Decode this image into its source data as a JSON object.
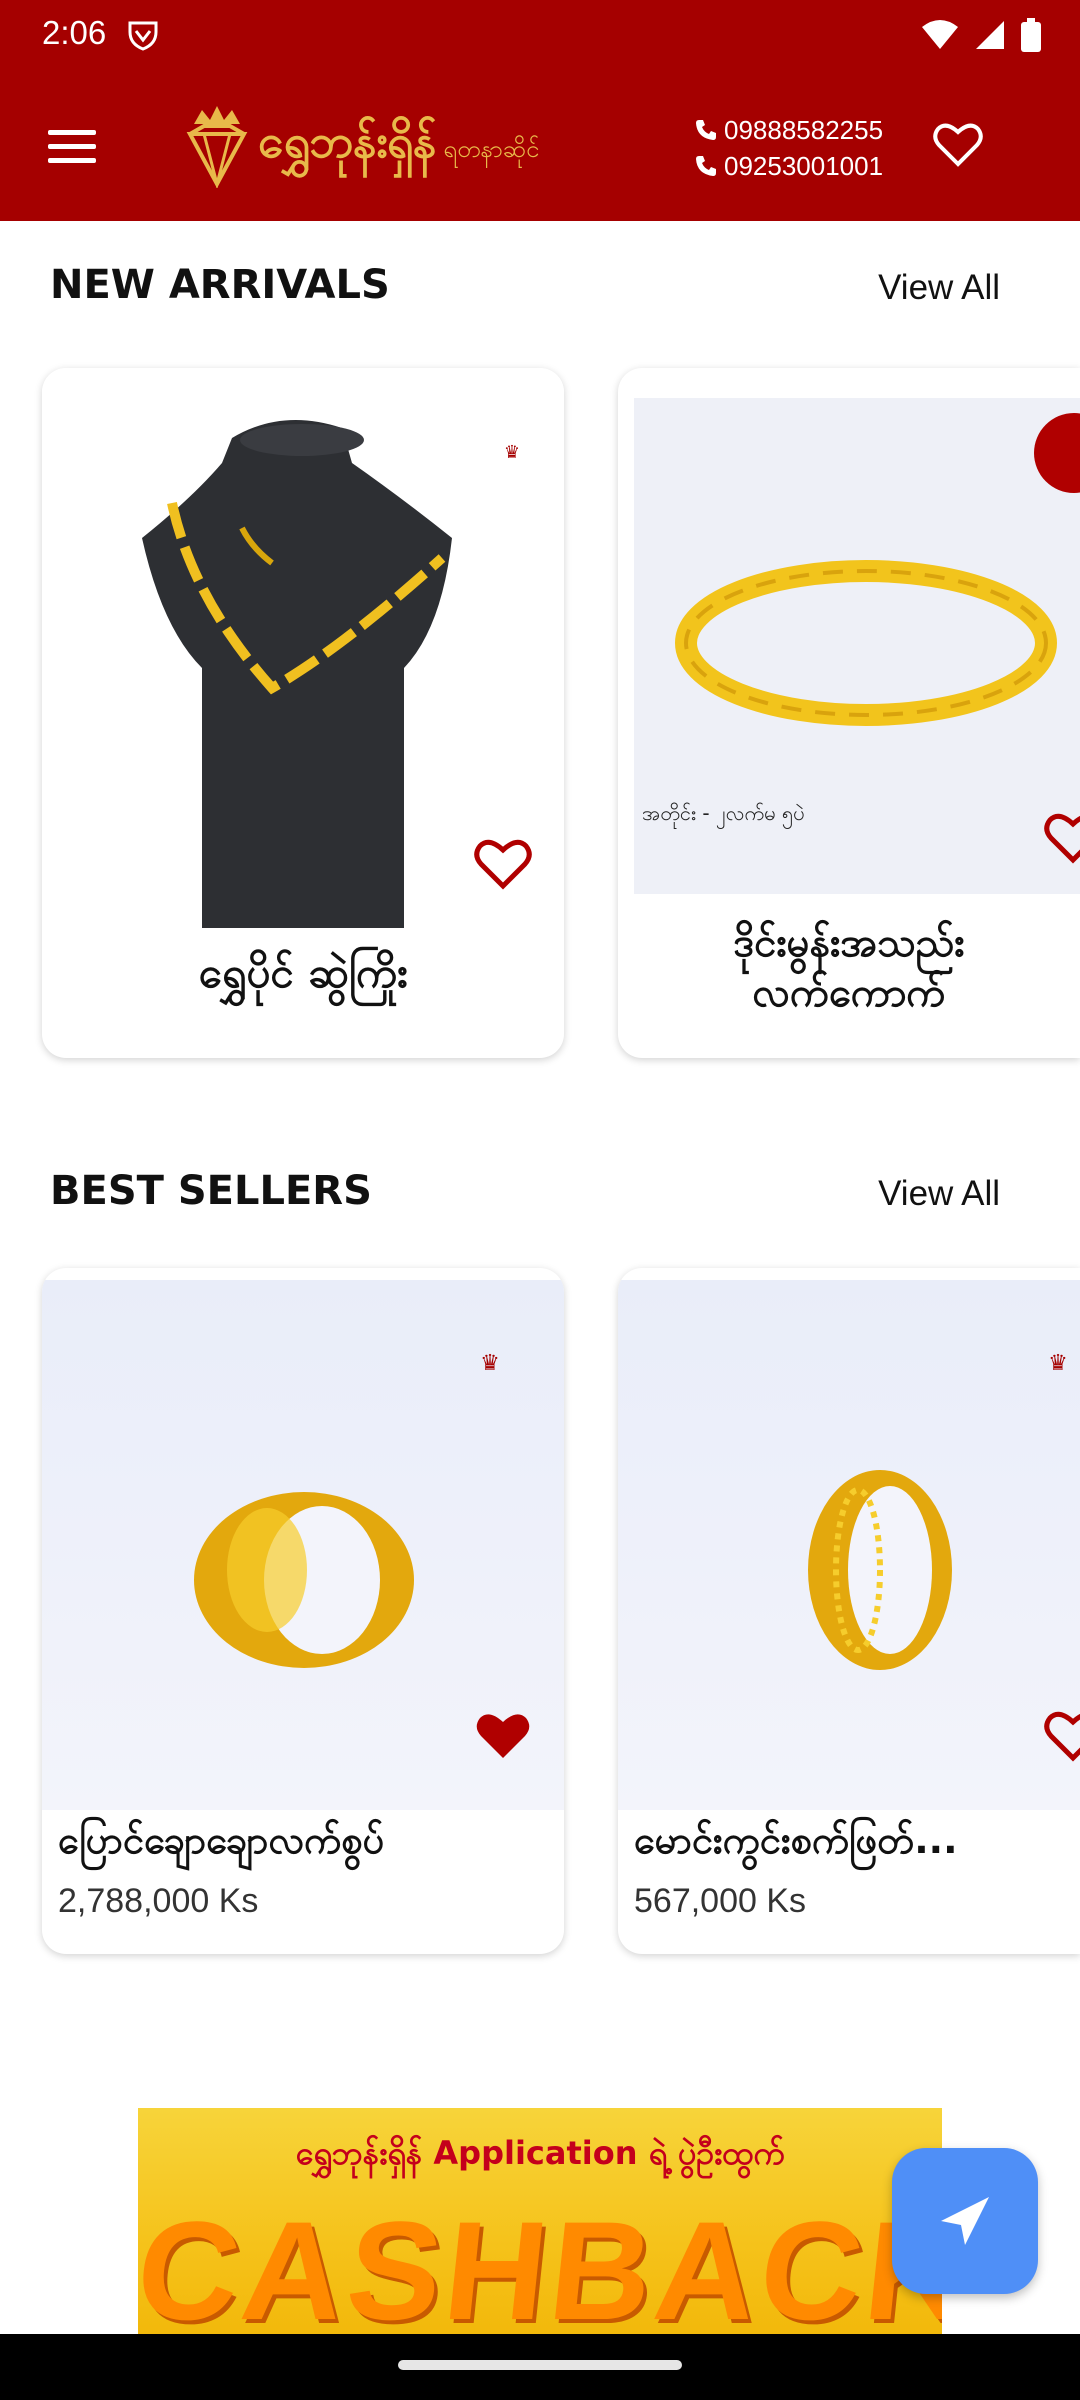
{
  "status_bar": {
    "time": "2:06"
  },
  "header": {
    "brand_name": "ရွှေဘုန်းရှိန်",
    "brand_sub": "ရတနာဆိုင်",
    "phone_1": "09888582255",
    "phone_2": "09253001001",
    "colors": {
      "bar": "#a50000",
      "gold": "#e8b94a"
    }
  },
  "new_arrivals": {
    "title": "NEW ARRIVALS",
    "view_all": "View All",
    "items": [
      {
        "name": "ရွှေပိုင် ဆွဲကြိုး",
        "favorited": false
      },
      {
        "name": "ဒိုင်းမွန်းအသည်း လက်ကောက်",
        "caption": "အတိုင်း - ၂လက်မ ၅ပဲ",
        "favorited": false
      }
    ]
  },
  "best_sellers": {
    "title": "BEST SELLERS",
    "view_all": "View All",
    "items": [
      {
        "name": "ပြောင်ချောချောလက်စွပ်",
        "price": "2,788,000 Ks",
        "favorited": true
      },
      {
        "name": "မောင်းကွင်းစက်ဖြတ်...",
        "price": "567,000 Ks",
        "favorited": false
      }
    ]
  },
  "banner": {
    "line1": "ရွှေဘုန်းရှိန် Application ရဲ့ ပွဲဦးထွက်",
    "headline": "CASHBACK"
  }
}
